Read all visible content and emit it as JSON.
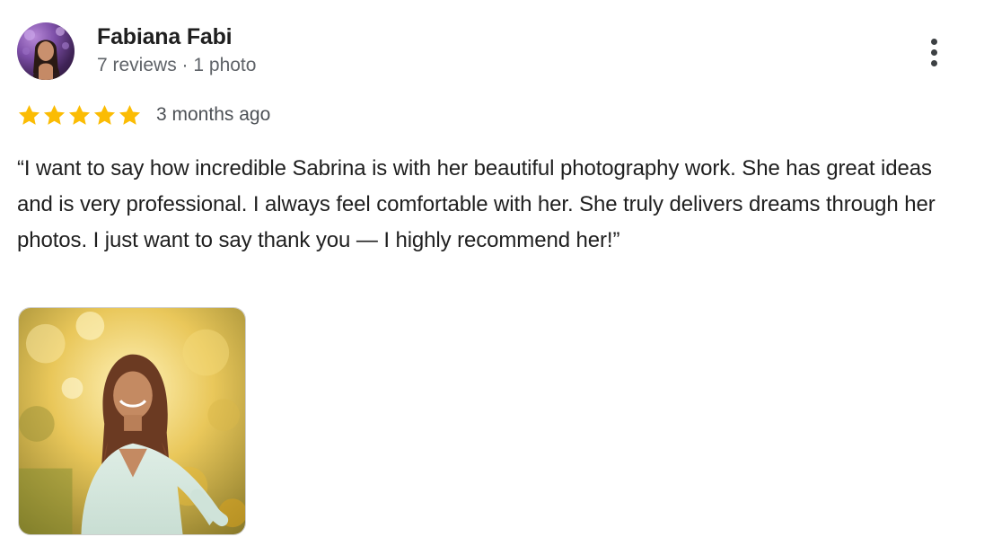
{
  "author": {
    "name": "Fabiana Fabi",
    "reviews_count": "7 reviews",
    "separator": " · ",
    "photos_count": "1 photo"
  },
  "review": {
    "rating": 5,
    "max_rating": 5,
    "date": "3 months ago",
    "text": "“I want to say how incredible Sabrina is with her beautiful photography work. She has great ideas and is very professional. I always feel comfortable with her. She truly delivers dreams through her photos. I just want to say thank you — I highly recommend her!”"
  },
  "icons": {
    "more": "more-vert-icon",
    "star": "star-icon"
  },
  "colors": {
    "star": "#fbbc04",
    "name": "#1f1f1f",
    "meta": "#5f6368"
  }
}
